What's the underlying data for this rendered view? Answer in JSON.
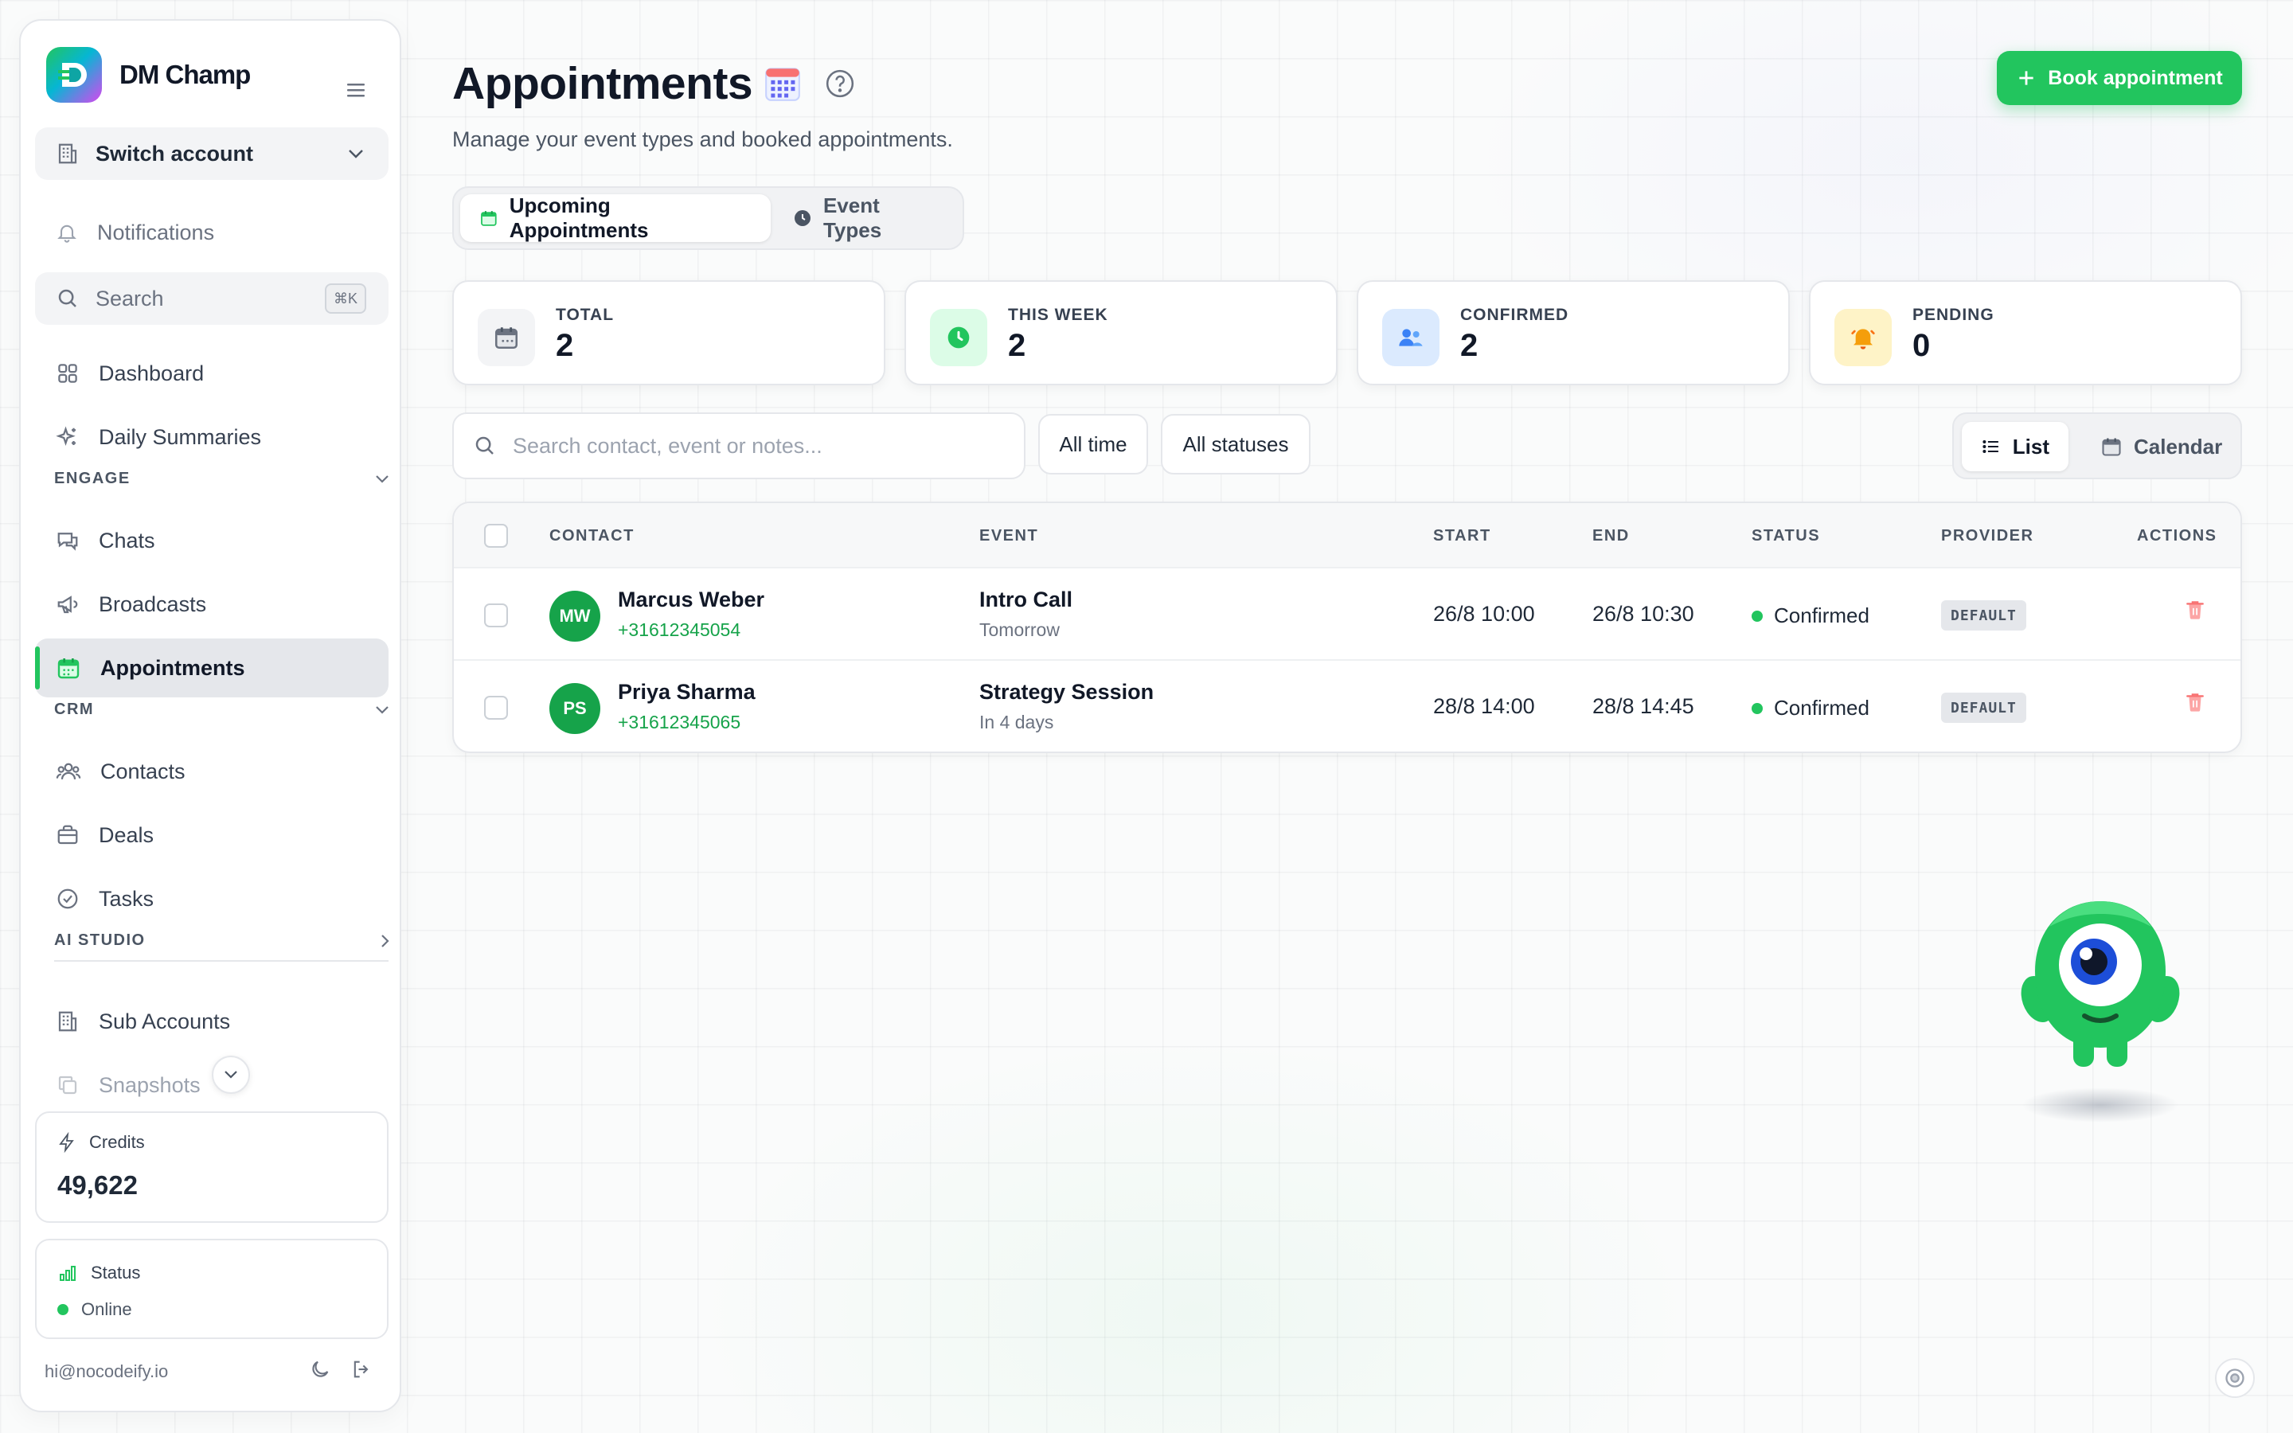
{
  "sidebar": {
    "brand": "DM Champ",
    "switch_account": "Switch account",
    "notifications": "Notifications",
    "search": {
      "label": "Search",
      "shortcut": "⌘K"
    },
    "items_top": [
      {
        "label": "Dashboard",
        "icon": "grid-icon"
      },
      {
        "label": "Daily Summaries",
        "icon": "sparkles-icon"
      }
    ],
    "sections": {
      "engage": "ENGAGE",
      "crm": "CRM",
      "ai_studio": "AI STUDIO"
    },
    "engage_items": [
      {
        "label": "Chats",
        "icon": "chat-icon"
      },
      {
        "label": "Broadcasts",
        "icon": "megaphone-icon"
      },
      {
        "label": "Appointments",
        "icon": "calendar-icon",
        "active": true
      }
    ],
    "crm_items": [
      {
        "label": "Contacts",
        "icon": "users-icon"
      },
      {
        "label": "Deals",
        "icon": "briefcase-icon"
      },
      {
        "label": "Tasks",
        "icon": "check-circle-icon"
      }
    ],
    "other_items": [
      {
        "label": "Sub Accounts",
        "icon": "building-icon"
      },
      {
        "label": "Snapshots",
        "icon": "copy-icon"
      }
    ],
    "credits": {
      "label": "Credits",
      "value": "49,622"
    },
    "status": {
      "label": "Status",
      "value": "Online"
    },
    "email": "hi@nocodeify.io"
  },
  "header": {
    "title": "Appointments",
    "subtitle": "Manage your event types and booked appointments.",
    "book_button": "Book appointment"
  },
  "tabs": [
    {
      "label": "Upcoming Appointments",
      "active": true
    },
    {
      "label": "Event Types",
      "active": false
    }
  ],
  "stats": [
    {
      "label": "TOTAL",
      "value": "2",
      "icon": "calendar-icon",
      "bg": "#f3f4f6",
      "color": "#6b7280"
    },
    {
      "label": "THIS WEEK",
      "value": "2",
      "icon": "clock-icon",
      "bg": "#dcfce7",
      "color": "#22c55e"
    },
    {
      "label": "CONFIRMED",
      "value": "2",
      "icon": "users-icon",
      "bg": "#dbeafe",
      "color": "#3b82f6"
    },
    {
      "label": "PENDING",
      "value": "0",
      "icon": "bell-icon",
      "bg": "#fef3c7",
      "color": "#f59e0b"
    }
  ],
  "filters": {
    "search_placeholder": "Search contact, event or notes...",
    "time": "All time",
    "status": "All statuses",
    "view_list": "List",
    "view_calendar": "Calendar"
  },
  "table": {
    "columns": [
      "CONTACT",
      "EVENT",
      "START",
      "END",
      "STATUS",
      "PROVIDER",
      "ACTIONS"
    ],
    "rows": [
      {
        "initials": "MW",
        "name": "Marcus Weber",
        "phone": "+31612345054",
        "event": "Intro Call",
        "when": "Tomorrow",
        "start": "26/8 10:00",
        "end": "26/8 10:30",
        "status": "Confirmed",
        "provider": "DEFAULT"
      },
      {
        "initials": "PS",
        "name": "Priya Sharma",
        "phone": "+31612345065",
        "event": "Strategy Session",
        "when": "In 4 days",
        "start": "28/8 14:00",
        "end": "28/8 14:45",
        "status": "Confirmed",
        "provider": "DEFAULT"
      }
    ]
  },
  "colors": {
    "accent": "#22c55e",
    "danger": "#f87171"
  }
}
